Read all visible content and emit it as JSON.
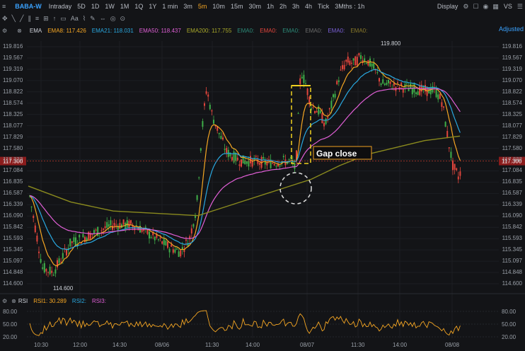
{
  "toolbar": {
    "symbol": "BABA-W",
    "intervals": [
      "Intraday",
      "5D",
      "1D",
      "1W",
      "1M",
      "1Q",
      "1Y",
      "1 min",
      "3m",
      "5m",
      "10m",
      "15m",
      "30m",
      "1h",
      "2h",
      "3h",
      "4h",
      "Tick"
    ],
    "active_interval": "5m",
    "range": "3Mths : 1h",
    "display": "Display",
    "vs": "VS"
  },
  "ema_legend": {
    "name": "EMA",
    "ema8": "EMA8: 117.426",
    "ema21": "EMA21: 118.031",
    "ema50": "EMA50: 118.437",
    "ema200": "EMA200: 117.755",
    "ema_blank_1": "EMA0:",
    "ema_blank_2": "EMA0:",
    "ema_blank_3": "EMA0:",
    "ema_blank_4": "EMA0:",
    "ema_blank_5": "EMA0:",
    "ema_blank_6": "EMA0:",
    "adjusted": "Adjusted"
  },
  "price_axis": [
    "119.816",
    "119.567",
    "119.319",
    "119.070",
    "118.822",
    "118.574",
    "118.325",
    "118.077",
    "117.829",
    "117.580",
    "117.332",
    "117.084",
    "116.835",
    "116.587",
    "116.339",
    "116.090",
    "115.842",
    "115.593",
    "115.345",
    "115.097",
    "114.848",
    "114.600"
  ],
  "current_price": "117.300",
  "annotations": {
    "high": "119.800",
    "low": "114.600",
    "gap_close": "Gap close"
  },
  "rsi_legend": {
    "name": "RSI",
    "rsi1": "RSI1: 30.289",
    "rsi2": "RSI2:",
    "rsi3": "RSI3:"
  },
  "rsi_axis": [
    "80.00",
    "50.00",
    "20.00"
  ],
  "time_axis": [
    "10:30",
    "12:00",
    "14:30",
    "08/06",
    "11:30",
    "14:00",
    "08/07",
    "11:30",
    "14:00",
    "08/08"
  ],
  "colors": {
    "ema8": "#f5a623",
    "ema21": "#29a8e0",
    "ema50": "#e05fd6",
    "ema200": "#8a8a1e",
    "up": "#3fae49",
    "down": "#e2453c"
  }
}
